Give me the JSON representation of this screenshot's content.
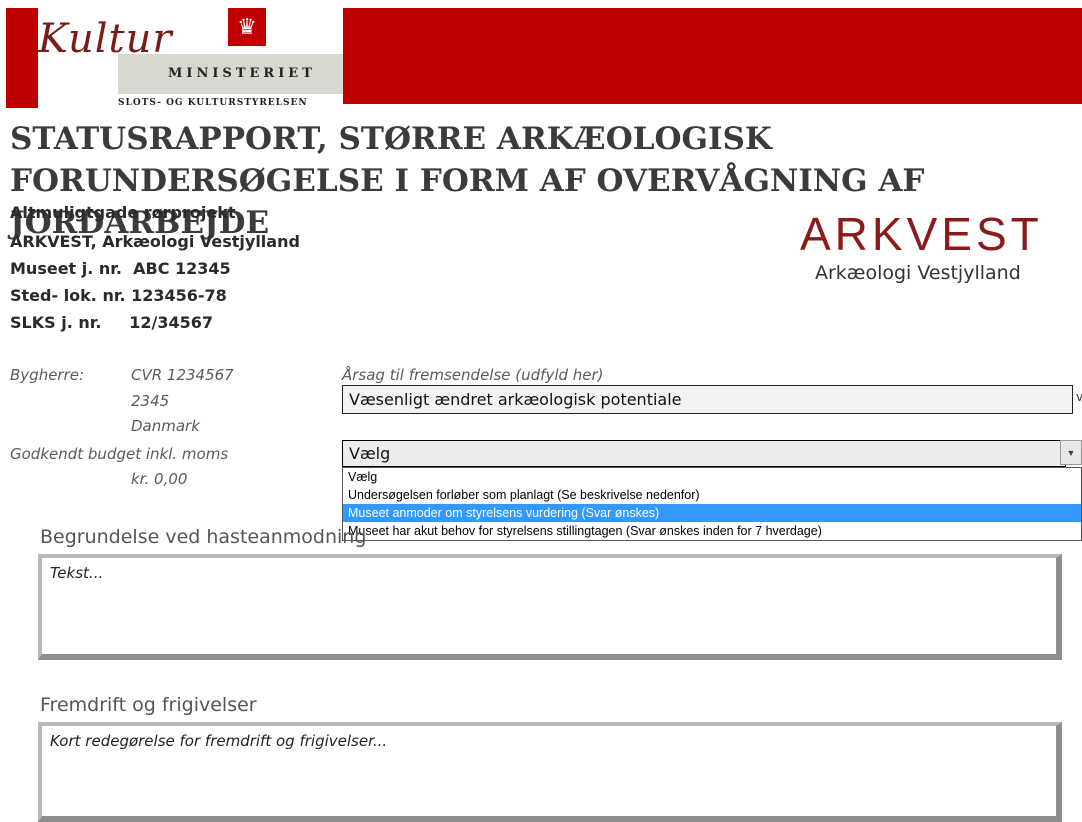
{
  "header": {
    "logo_script": "Kultur",
    "logo_line1": "MINISTERIET",
    "logo_line2": "SLOTS- OG KULTURSTYRELSEN",
    "crown_icon": "♛",
    "brand_color": "#c00000"
  },
  "title": "STATUSRAPPORT, STØRRE ARKÆOLOGISK FORUNDERSØGELSE I FORM AF OVERVÅGNING AF JORDARBEJDE",
  "info": {
    "project": "Altmuligtgade rørprojekt",
    "museum": "ARKVEST, Arkæologi Vestjylland",
    "museum_jnr": "Museet j. nr.  ABC 12345",
    "sted_lok": "Sted- lok. nr. 123456-78",
    "slks": "SLKS j. nr.     12/34567"
  },
  "arkvest_logo": {
    "main": "ARKVEST",
    "sub": "Arkæologi Vestjylland"
  },
  "bygherre": {
    "label": "Bygherre:",
    "cvr": "CVR 1234567",
    "postal": "2345",
    "country": "Danmark"
  },
  "budget": {
    "label": "Godkendt budget inkl. moms",
    "value": "kr. 0,00"
  },
  "cause": {
    "label": "Årsag til fremsendelse (udfyld her)",
    "value": "Væsenligt ændret arkæologisk potentiale",
    "marker": "v"
  },
  "priority": {
    "value": "Vælg",
    "options": [
      "Vælg",
      "Undersøgelsen forløber som planlagt (Se beskrivelse nedenfor)",
      "Museet anmoder om styrelsens vurdering (Svar ønskes)",
      "Museet har akut behov for styrelsens stillingtagen (Svar ønskes inden for 7 hverdage)"
    ],
    "selected_index": 2
  },
  "sections": {
    "hast_label": "Begrundelse ved hasteanmodning",
    "hast_text": "Tekst...",
    "fremdrift_label": "Fremdrift og frigivelser",
    "fremdrift_text": "Kort redegørelse  for fremdrift  og frigivelser..."
  }
}
